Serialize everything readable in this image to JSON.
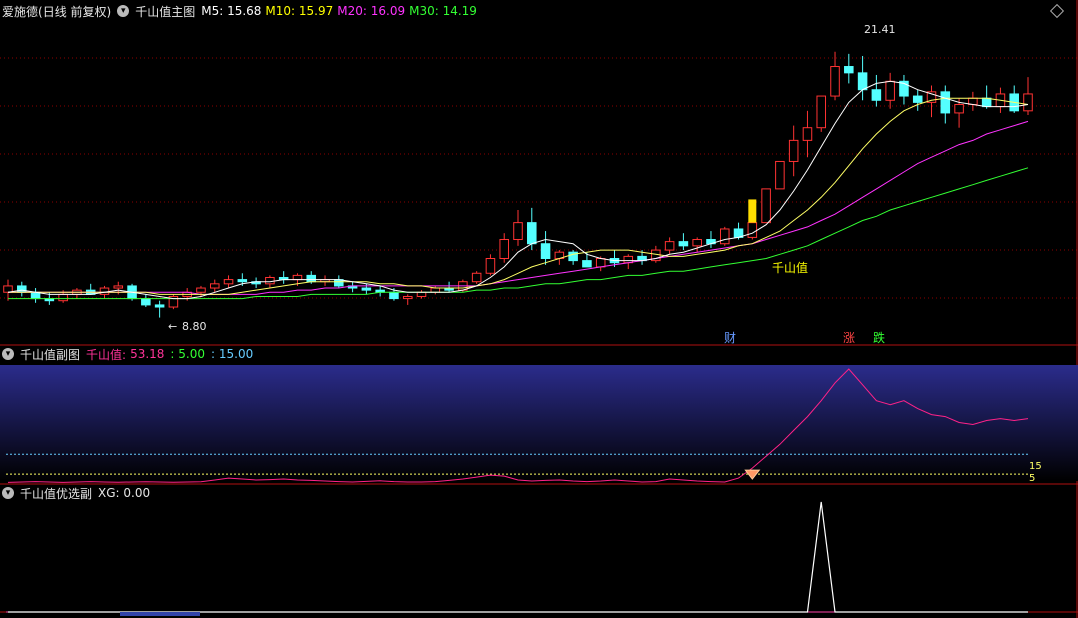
{
  "main_panel": {
    "stock_name": "爱施德",
    "period": "(日线 前复权)",
    "indicator": "千山值主图",
    "ma": [
      {
        "label": "M5:",
        "value": "15.68",
        "color": "#ffffff"
      },
      {
        "label": "M10:",
        "value": "15.97",
        "color": "#ffff00"
      },
      {
        "label": "M20:",
        "value": "16.09",
        "color": "#ff33ff"
      },
      {
        "label": "M30:",
        "value": "14.19",
        "color": "#33ff33"
      }
    ],
    "high_label": "21.41",
    "low_label": "8.80",
    "signal_label": "千山值",
    "markers": [
      {
        "text": "财",
        "color": "#6699ff"
      },
      {
        "text": "涨",
        "color": "#ff4444"
      },
      {
        "text": "跌",
        "color": "#33ff33"
      }
    ]
  },
  "sub_panel_1": {
    "indicator": "千山值副图",
    "series_label": "千山值:",
    "value": "53.18",
    "line_a": ": 5.00",
    "line_b": ": 15.00",
    "level_15": "15",
    "level_5": "5"
  },
  "sub_panel_2": {
    "indicator": "千山值优选副",
    "value": "XG: 0.00"
  },
  "colors": {
    "up": "#ff3333",
    "down": "#54ffff",
    "ma5": "#ffffff",
    "ma10": "#ffff66",
    "ma20": "#ff33ff",
    "ma30": "#33ff33",
    "grid": "#8b0000"
  },
  "chart_data": {
    "type": "candlestick",
    "price_range": [
      7.5,
      23.0
    ],
    "candles": [
      [
        10.0,
        10.6,
        9.6,
        10.3
      ],
      [
        10.3,
        10.5,
        9.8,
        10.0
      ],
      [
        10.0,
        10.2,
        9.5,
        9.7
      ],
      [
        9.7,
        10.0,
        9.4,
        9.6
      ],
      [
        9.6,
        10.1,
        9.5,
        9.9
      ],
      [
        9.9,
        10.2,
        9.7,
        10.1
      ],
      [
        10.1,
        10.4,
        9.9,
        9.9
      ],
      [
        9.9,
        10.3,
        9.7,
        10.2
      ],
      [
        10.2,
        10.5,
        9.9,
        10.3
      ],
      [
        10.3,
        10.4,
        9.6,
        9.7
      ],
      [
        9.7,
        9.9,
        9.3,
        9.4
      ],
      [
        9.4,
        9.6,
        8.8,
        9.3
      ],
      [
        9.3,
        9.9,
        9.2,
        9.8
      ],
      [
        9.8,
        10.2,
        9.6,
        10.0
      ],
      [
        10.0,
        10.3,
        9.8,
        10.2
      ],
      [
        10.2,
        10.6,
        10.0,
        10.4
      ],
      [
        10.4,
        10.8,
        10.2,
        10.6
      ],
      [
        10.6,
        10.9,
        10.3,
        10.5
      ],
      [
        10.5,
        10.7,
        10.2,
        10.4
      ],
      [
        10.4,
        10.8,
        10.2,
        10.7
      ],
      [
        10.7,
        11.0,
        10.4,
        10.6
      ],
      [
        10.6,
        10.9,
        10.3,
        10.8
      ],
      [
        10.8,
        11.0,
        10.4,
        10.5
      ],
      [
        10.5,
        10.8,
        10.3,
        10.6
      ],
      [
        10.6,
        10.8,
        10.2,
        10.3
      ],
      [
        10.3,
        10.5,
        10.0,
        10.2
      ],
      [
        10.2,
        10.4,
        9.9,
        10.1
      ],
      [
        10.1,
        10.3,
        9.8,
        10.0
      ],
      [
        10.0,
        10.2,
        9.6,
        9.7
      ],
      [
        9.7,
        9.9,
        9.4,
        9.8
      ],
      [
        9.8,
        10.1,
        9.7,
        10.0
      ],
      [
        10.0,
        10.3,
        9.9,
        10.2
      ],
      [
        10.2,
        10.5,
        10.0,
        10.1
      ],
      [
        10.1,
        10.6,
        10.0,
        10.5
      ],
      [
        10.5,
        11.0,
        10.4,
        10.9
      ],
      [
        10.9,
        11.8,
        10.8,
        11.6
      ],
      [
        11.6,
        12.8,
        11.4,
        12.5
      ],
      [
        12.5,
        13.9,
        12.2,
        13.3
      ],
      [
        13.3,
        14.0,
        12.0,
        12.3
      ],
      [
        12.3,
        12.9,
        11.3,
        11.6
      ],
      [
        11.6,
        12.0,
        11.3,
        11.9
      ],
      [
        11.9,
        12.0,
        11.3,
        11.5
      ],
      [
        11.5,
        11.9,
        11.2,
        11.2
      ],
      [
        11.2,
        11.7,
        11.0,
        11.6
      ],
      [
        11.6,
        12.0,
        11.2,
        11.4
      ],
      [
        11.4,
        11.8,
        11.1,
        11.7
      ],
      [
        11.7,
        12.0,
        11.3,
        11.5
      ],
      [
        11.5,
        12.2,
        11.4,
        12.0
      ],
      [
        12.0,
        12.6,
        11.8,
        12.4
      ],
      [
        12.4,
        12.8,
        12.0,
        12.2
      ],
      [
        12.2,
        12.6,
        11.9,
        12.5
      ],
      [
        12.5,
        12.9,
        12.1,
        12.3
      ],
      [
        12.3,
        13.1,
        12.2,
        13.0
      ],
      [
        13.0,
        13.3,
        12.5,
        12.6
      ],
      [
        12.6,
        13.3,
        12.5,
        13.3
      ],
      [
        13.3,
        14.9,
        13.3,
        14.9
      ],
      [
        14.9,
        16.2,
        14.9,
        16.2
      ],
      [
        16.2,
        17.9,
        15.5,
        17.2
      ],
      [
        17.2,
        18.6,
        16.4,
        17.8
      ],
      [
        17.8,
        19.3,
        17.6,
        19.3
      ],
      [
        19.3,
        21.4,
        19.1,
        20.7
      ],
      [
        20.7,
        21.3,
        19.9,
        20.4
      ],
      [
        20.4,
        21.2,
        19.1,
        19.6
      ],
      [
        19.6,
        20.3,
        18.8,
        19.1
      ],
      [
        19.1,
        20.4,
        18.7,
        20.0
      ],
      [
        20.0,
        20.3,
        18.9,
        19.3
      ],
      [
        19.3,
        19.6,
        18.6,
        19.0
      ],
      [
        19.0,
        19.8,
        18.3,
        19.5
      ],
      [
        19.5,
        19.8,
        18.0,
        18.5
      ],
      [
        18.5,
        19.2,
        17.8,
        18.9
      ],
      [
        18.9,
        19.5,
        18.6,
        19.2
      ],
      [
        19.2,
        19.8,
        18.7,
        18.8
      ],
      [
        18.8,
        19.7,
        18.5,
        19.4
      ],
      [
        19.4,
        19.8,
        18.5,
        18.6
      ],
      [
        18.6,
        20.2,
        18.4,
        19.4
      ]
    ],
    "ma5": [
      10.0,
      10.1,
      10.0,
      9.9,
      9.9,
      9.9,
      9.9,
      10.0,
      10.1,
      10.0,
      9.9,
      9.8,
      9.7,
      9.7,
      9.8,
      10.0,
      10.2,
      10.4,
      10.5,
      10.5,
      10.6,
      10.6,
      10.6,
      10.6,
      10.6,
      10.5,
      10.4,
      10.3,
      10.1,
      10.0,
      10.0,
      10.0,
      10.0,
      10.1,
      10.3,
      10.7,
      11.2,
      11.9,
      12.3,
      12.5,
      12.4,
      12.3,
      11.8,
      11.6,
      11.5,
      11.5,
      11.5,
      11.6,
      11.8,
      11.9,
      12.1,
      12.3,
      12.5,
      12.6,
      12.8,
      13.2,
      13.9,
      14.8,
      15.8,
      16.9,
      18.0,
      19.0,
      19.6,
      19.9,
      20.0,
      19.9,
      19.6,
      19.4,
      19.2,
      19.0,
      18.9,
      18.8,
      18.8,
      18.8,
      18.9
    ],
    "ma10": [
      10.0,
      10.0,
      10.0,
      10.0,
      10.0,
      10.0,
      10.0,
      10.0,
      10.0,
      10.0,
      10.0,
      9.9,
      9.9,
      9.9,
      9.9,
      9.9,
      9.9,
      10.0,
      10.1,
      10.2,
      10.3,
      10.4,
      10.5,
      10.5,
      10.5,
      10.5,
      10.5,
      10.4,
      10.4,
      10.3,
      10.3,
      10.2,
      10.2,
      10.2,
      10.3,
      10.4,
      10.6,
      10.9,
      11.2,
      11.4,
      11.6,
      11.8,
      11.9,
      12.0,
      12.0,
      12.0,
      11.9,
      11.8,
      11.7,
      11.7,
      11.8,
      11.9,
      12.0,
      12.2,
      12.3,
      12.6,
      12.9,
      13.4,
      13.9,
      14.5,
      15.2,
      16.0,
      16.8,
      17.5,
      18.1,
      18.6,
      18.9,
      19.1,
      19.2,
      19.2,
      19.2,
      19.2,
      19.1,
      19.0,
      18.9
    ],
    "ma20": [
      10.0,
      10.0,
      10.0,
      10.0,
      10.0,
      10.0,
      10.0,
      10.0,
      10.0,
      10.0,
      10.0,
      10.0,
      10.0,
      10.0,
      9.9,
      9.9,
      9.9,
      9.9,
      9.9,
      10.0,
      10.0,
      10.1,
      10.1,
      10.2,
      10.2,
      10.3,
      10.3,
      10.3,
      10.3,
      10.3,
      10.3,
      10.3,
      10.3,
      10.3,
      10.3,
      10.4,
      10.5,
      10.6,
      10.7,
      10.8,
      10.9,
      11.0,
      11.1,
      11.2,
      11.3,
      11.4,
      11.5,
      11.6,
      11.7,
      11.8,
      11.9,
      12.0,
      12.1,
      12.2,
      12.3,
      12.5,
      12.7,
      12.9,
      13.1,
      13.4,
      13.7,
      14.1,
      14.5,
      14.9,
      15.3,
      15.7,
      16.1,
      16.4,
      16.7,
      17.0,
      17.2,
      17.5,
      17.7,
      17.9,
      18.1
    ],
    "ma30": [
      9.7,
      9.7,
      9.7,
      9.7,
      9.7,
      9.7,
      9.7,
      9.7,
      9.7,
      9.7,
      9.7,
      9.7,
      9.7,
      9.7,
      9.7,
      9.7,
      9.7,
      9.7,
      9.8,
      9.8,
      9.8,
      9.8,
      9.9,
      9.9,
      9.9,
      9.9,
      9.9,
      10.0,
      10.0,
      10.0,
      10.0,
      10.0,
      10.0,
      10.0,
      10.1,
      10.1,
      10.2,
      10.2,
      10.3,
      10.4,
      10.4,
      10.5,
      10.6,
      10.6,
      10.7,
      10.8,
      10.8,
      10.9,
      11.0,
      11.0,
      11.1,
      11.2,
      11.3,
      11.4,
      11.5,
      11.6,
      11.8,
      12.0,
      12.2,
      12.5,
      12.8,
      13.1,
      13.4,
      13.6,
      13.9,
      14.1,
      14.3,
      14.5,
      14.7,
      14.9,
      15.1,
      15.3,
      15.5,
      15.7,
      15.9
    ],
    "sub1_range": [
      0,
      60
    ],
    "sub1_line": [
      0.8,
      1.0,
      1.2,
      1.0,
      0.8,
      1.0,
      1.2,
      1.0,
      0.9,
      1.0,
      1.1,
      1.0,
      0.9,
      1.0,
      1.1,
      2.0,
      3.0,
      2.5,
      2.0,
      2.2,
      2.5,
      2.0,
      1.8,
      1.5,
      1.2,
      1.0,
      1.3,
      1.6,
      1.2,
      1.0,
      1.0,
      1.2,
      1.8,
      2.5,
      3.5,
      4.5,
      4.0,
      2.0,
      1.5,
      1.8,
      2.0,
      1.5,
      1.2,
      1.5,
      2.0,
      1.5,
      1.0,
      1.2,
      2.5,
      2.0,
      1.5,
      1.2,
      1.0,
      3.0,
      8.0,
      14.0,
      20.0,
      27.0,
      34.0,
      42.0,
      51.0,
      58.0,
      50.0,
      42.0,
      40.0,
      42.0,
      38.0,
      35.0,
      34.0,
      31.0,
      30.0,
      32.0,
      33.0,
      32.0,
      33.0
    ],
    "sub2_range": [
      0,
      1
    ],
    "sub2_line": [
      0,
      0,
      0,
      0,
      0,
      0,
      0,
      0,
      0,
      0,
      0,
      0,
      0,
      0,
      0,
      0,
      0,
      0,
      0,
      0,
      0,
      0,
      0,
      0,
      0,
      0,
      0,
      0,
      0,
      0,
      0,
      0,
      0,
      0,
      0,
      0,
      0,
      0,
      0,
      0,
      0,
      0,
      0,
      0,
      0,
      0,
      0,
      0,
      0,
      0,
      0,
      0,
      0,
      0,
      0,
      0,
      0,
      0,
      0,
      1,
      0,
      0,
      0,
      0,
      0,
      0,
      0,
      0,
      0,
      0,
      0,
      0,
      0,
      0,
      0
    ]
  }
}
